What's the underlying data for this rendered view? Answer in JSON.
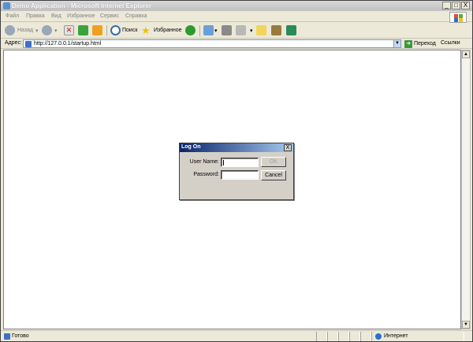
{
  "window": {
    "title": "Demo Application - Microsoft Internet Explorer",
    "controls": [
      "_",
      "□",
      "X"
    ]
  },
  "menu": [
    "Файл",
    "Правка",
    "Вид",
    "Избранное",
    "Сервис",
    "Справка"
  ],
  "toolbar": {
    "back_label": "Назад",
    "search_label": "Поиск",
    "favorites_label": "Избранное"
  },
  "address": {
    "label": "Адрес:",
    "url": "http://127.0.0.1/startup.html",
    "go_label": "Переход",
    "links_label": "Ссылки"
  },
  "dialog": {
    "title": "Log On",
    "close": "X",
    "username_label": "User Name:",
    "username_value": "",
    "password_label": "Password:",
    "password_value": "",
    "ok_label": "OK",
    "cancel_label": "Cancel"
  },
  "status": {
    "text": "Готово",
    "zone": "Интернет"
  }
}
